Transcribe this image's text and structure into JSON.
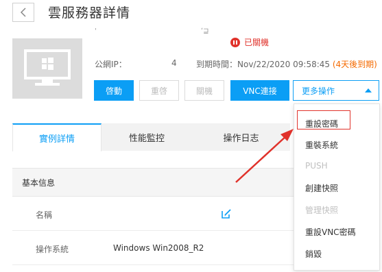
{
  "header": {
    "title": "雲服務器詳情"
  },
  "instance": {
    "name_partial": "'",
    "name_partial_2": "ʻ⊒",
    "status": "已關機",
    "ip_label": "公網IP：",
    "ip_value_partial": "4",
    "expire_label": "到期時間：Nov/22/2020 09:58:45 ",
    "expire_warning": "(4天後到期)"
  },
  "actions": {
    "start": "啓動",
    "restart": "重啓",
    "shutdown": "關機",
    "vnc": "VNC連接",
    "more": "更多操作"
  },
  "tabs": [
    "實例詳情",
    "性能監控",
    "操作日志"
  ],
  "section": {
    "title": "基本信息",
    "rows": [
      {
        "label": "名稱",
        "value": ""
      },
      {
        "label": "操作系統",
        "value": "Windows Win2008_R2"
      }
    ]
  },
  "dropdown": {
    "items": [
      {
        "label": "重設密碼",
        "enabled": true
      },
      {
        "label": "重裝系統",
        "enabled": true
      },
      {
        "label": "PUSH",
        "enabled": false
      },
      {
        "label": "創建快照",
        "enabled": true
      },
      {
        "label": "管理快照",
        "enabled": false
      },
      {
        "label": "重設VNC密碼",
        "enabled": true
      },
      {
        "label": "銷毀",
        "enabled": true
      }
    ]
  },
  "colors": {
    "accent": "#0b9ef5",
    "danger": "#e0322b",
    "warning": "#f56a00"
  }
}
